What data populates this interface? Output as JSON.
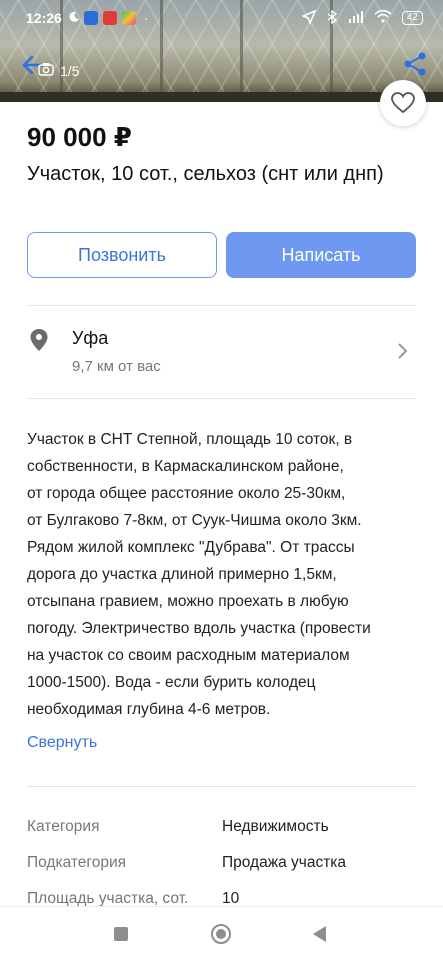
{
  "status": {
    "time": "12:26",
    "battery": "42"
  },
  "gallery": {
    "counter": "1/5"
  },
  "listing": {
    "price": "90 000 ₽",
    "title": "Участок, 10 сот., сельхоз (снт или днп)"
  },
  "actions": {
    "call": "Позвонить",
    "write": "Написать"
  },
  "location": {
    "city": "Уфа",
    "distance": "9,7 км от вас"
  },
  "description": {
    "lines": [
      "Участок в СНТ Степной, площадь 10 соток, в",
      "собственности, в Кармаскалинском районе,",
      "от города общее расстояние около 25-30км,",
      "от Булгаково 7-8км, от Суук-Чишма около 3км.",
      "Рядом жилой комплекс \"Дубрава\". От трассы",
      "дорога до участка длиной примерно 1,5км,",
      "отсыпана гравием, можно проехать в любую",
      "погоду. Электричество вдоль участка (провести",
      "на участок со своим расходным материалом",
      "1000-1500). Вода - если бурить колодец",
      "необходимая глубина 4-6 метров."
    ],
    "collapse": "Свернуть"
  },
  "specs": [
    {
      "label": "Категория",
      "value": "Недвижимость"
    },
    {
      "label": "Подкатегория",
      "value": "Продажа участка"
    },
    {
      "label": "Площадь участка, сот.",
      "value": "10"
    }
  ],
  "colors": {
    "accent": "#6f99f0",
    "link": "#3c72e0"
  }
}
